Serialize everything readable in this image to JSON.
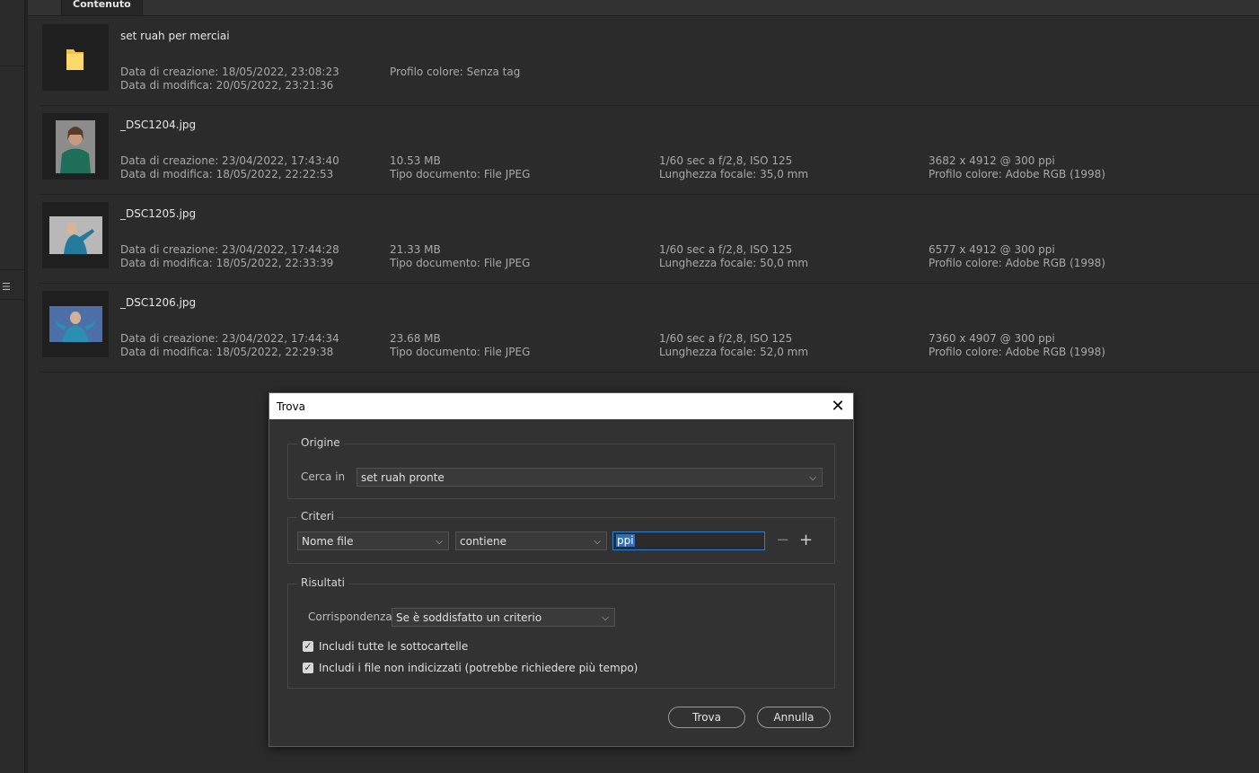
{
  "panel": {
    "tab_label": "Contenuto"
  },
  "items": [
    {
      "name": "set ruah per merciai",
      "thumb": "folder-icon",
      "created": "Data di creazione: 18/05/2022, 23:08:23",
      "modified": "Data di modifica: 20/05/2022, 23:21:36",
      "col2_l1": "Profilo colore: Senza tag",
      "col2_l2": "",
      "col3_l1": "",
      "col3_l2": "",
      "col4_l1": "",
      "col4_l2": ""
    },
    {
      "name": "_DSC1204.jpg",
      "thumb": "photo-portrait-green",
      "created": "Data di creazione: 23/04/2022, 17:43:40",
      "modified": "Data di modifica: 18/05/2022, 22:22:53",
      "col2_l1": "10.53 MB",
      "col2_l2": "Tipo documento: File JPEG",
      "col3_l1": "1/60 sec a f/2,8, ISO 125",
      "col3_l2": "Lunghezza focale: 35,0 mm",
      "col4_l1": "3682 x 4912 @ 300 ppi",
      "col4_l2": "Profilo colore: Adobe RGB (1998)"
    },
    {
      "name": "_DSC1205.jpg",
      "thumb": "photo-landscape-teal",
      "created": "Data di creazione: 23/04/2022, 17:44:28",
      "modified": "Data di modifica: 18/05/2022, 22:33:39",
      "col2_l1": "21.33 MB",
      "col2_l2": "Tipo documento: File JPEG",
      "col3_l1": "1/60 sec a f/2,8, ISO 125",
      "col3_l2": "Lunghezza focale: 50,0 mm",
      "col4_l1": "6577 x 4912 @ 300 ppi",
      "col4_l2": "Profilo colore: Adobe RGB (1998)"
    },
    {
      "name": "_DSC1206.jpg",
      "thumb": "photo-landscape-blue",
      "created": "Data di creazione: 23/04/2022, 17:44:34",
      "modified": "Data di modifica: 18/05/2022, 22:29:38",
      "col2_l1": "23.68 MB",
      "col2_l2": "Tipo documento: File JPEG",
      "col3_l1": "1/60 sec a f/2,8, ISO 125",
      "col3_l2": "Lunghezza focale: 52,0 mm",
      "col4_l1": "7360 x 4907 @ 300 ppi",
      "col4_l2": "Profilo colore: Adobe RGB (1998)"
    }
  ],
  "dialog": {
    "title": "Trova",
    "close_icon": "close-icon",
    "origin": {
      "legend": "Origine",
      "search_in_label": "Cerca in",
      "search_in_value": "set ruah pronte"
    },
    "criteria": {
      "legend": "Criteri",
      "field_value": "Nome file",
      "operator_value": "contiene",
      "text_value": "ppi",
      "remove_icon": "minus-icon",
      "add_icon": "plus-icon"
    },
    "results": {
      "legend": "Risultati",
      "match_label": "Corrispondenza",
      "match_value": "Se è soddisfatto un criterio",
      "include_subfolders": "Includi tutte le sottocartelle",
      "include_subfolders_checked": true,
      "include_nonindexed": "Includi i file non indicizzati (potrebbe richiedere più tempo)",
      "include_nonindexed_checked": true
    },
    "find_button": "Trova",
    "cancel_button": "Annulla"
  }
}
